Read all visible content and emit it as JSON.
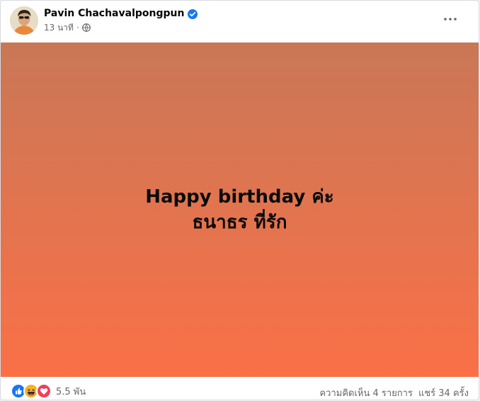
{
  "post": {
    "author": "Pavin Chachavalpongpun",
    "time": "13 นาที",
    "text_lines": [
      "Happy birthday ค่ะ",
      "ธนาธร ที่รัก"
    ],
    "background_colors": [
      "#c97756",
      "#fa7047"
    ]
  },
  "footer": {
    "reaction_count": "5.5 พัน",
    "comments": "ความคิดเห็น 4 รายการ",
    "shares": "แชร์ 34 ครั้ง"
  },
  "icons": {
    "verified": "verified-badge-icon",
    "audience": "globe-icon",
    "more": "more-options-icon",
    "reactions": [
      "like-icon",
      "haha-icon",
      "love-icon"
    ]
  },
  "colors": {
    "accent": "#1877f2",
    "secondary_text": "#65676b"
  }
}
